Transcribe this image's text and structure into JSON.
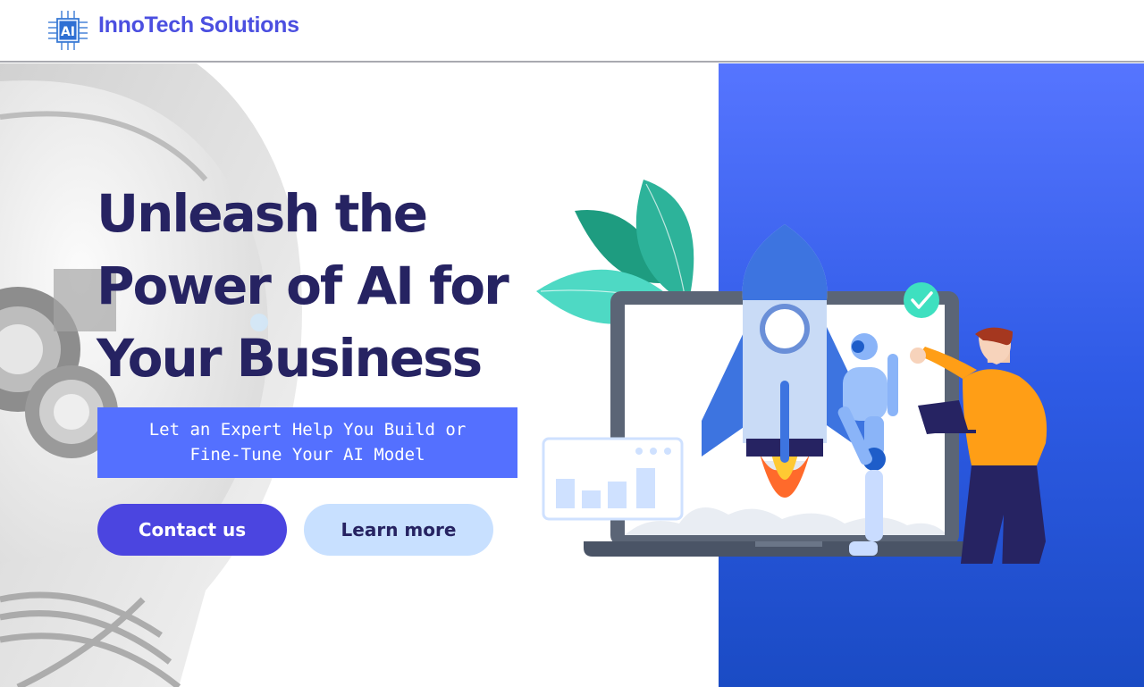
{
  "header": {
    "brand_name": "InnoTech Solutions",
    "logo_icon": "ai-chip-icon",
    "logo_text": "AI"
  },
  "hero": {
    "headline_lines": [
      "Unleash the",
      "Power of AI for",
      "Your Business"
    ],
    "tagline_lines": [
      "Let an Expert Help You Build or",
      "Fine-Tune Your AI Model"
    ],
    "buttons": {
      "contact": "Contact us",
      "learn": "Learn more"
    }
  },
  "colors": {
    "brand": "#4b4fe0",
    "headline": "#262362",
    "tagline_bg": "#5470ff",
    "contact_bg": "#4b45e0",
    "learn_bg": "#c8e0ff",
    "panel_top": "#5675ff",
    "panel_bottom": "#1a4bc4"
  },
  "icons": [
    "ai-chip-icon",
    "rocket-icon",
    "checkmark-icon",
    "leaves-icon",
    "bar-chart-icon",
    "robot-icon",
    "person-icon",
    "laptop-icon"
  ]
}
